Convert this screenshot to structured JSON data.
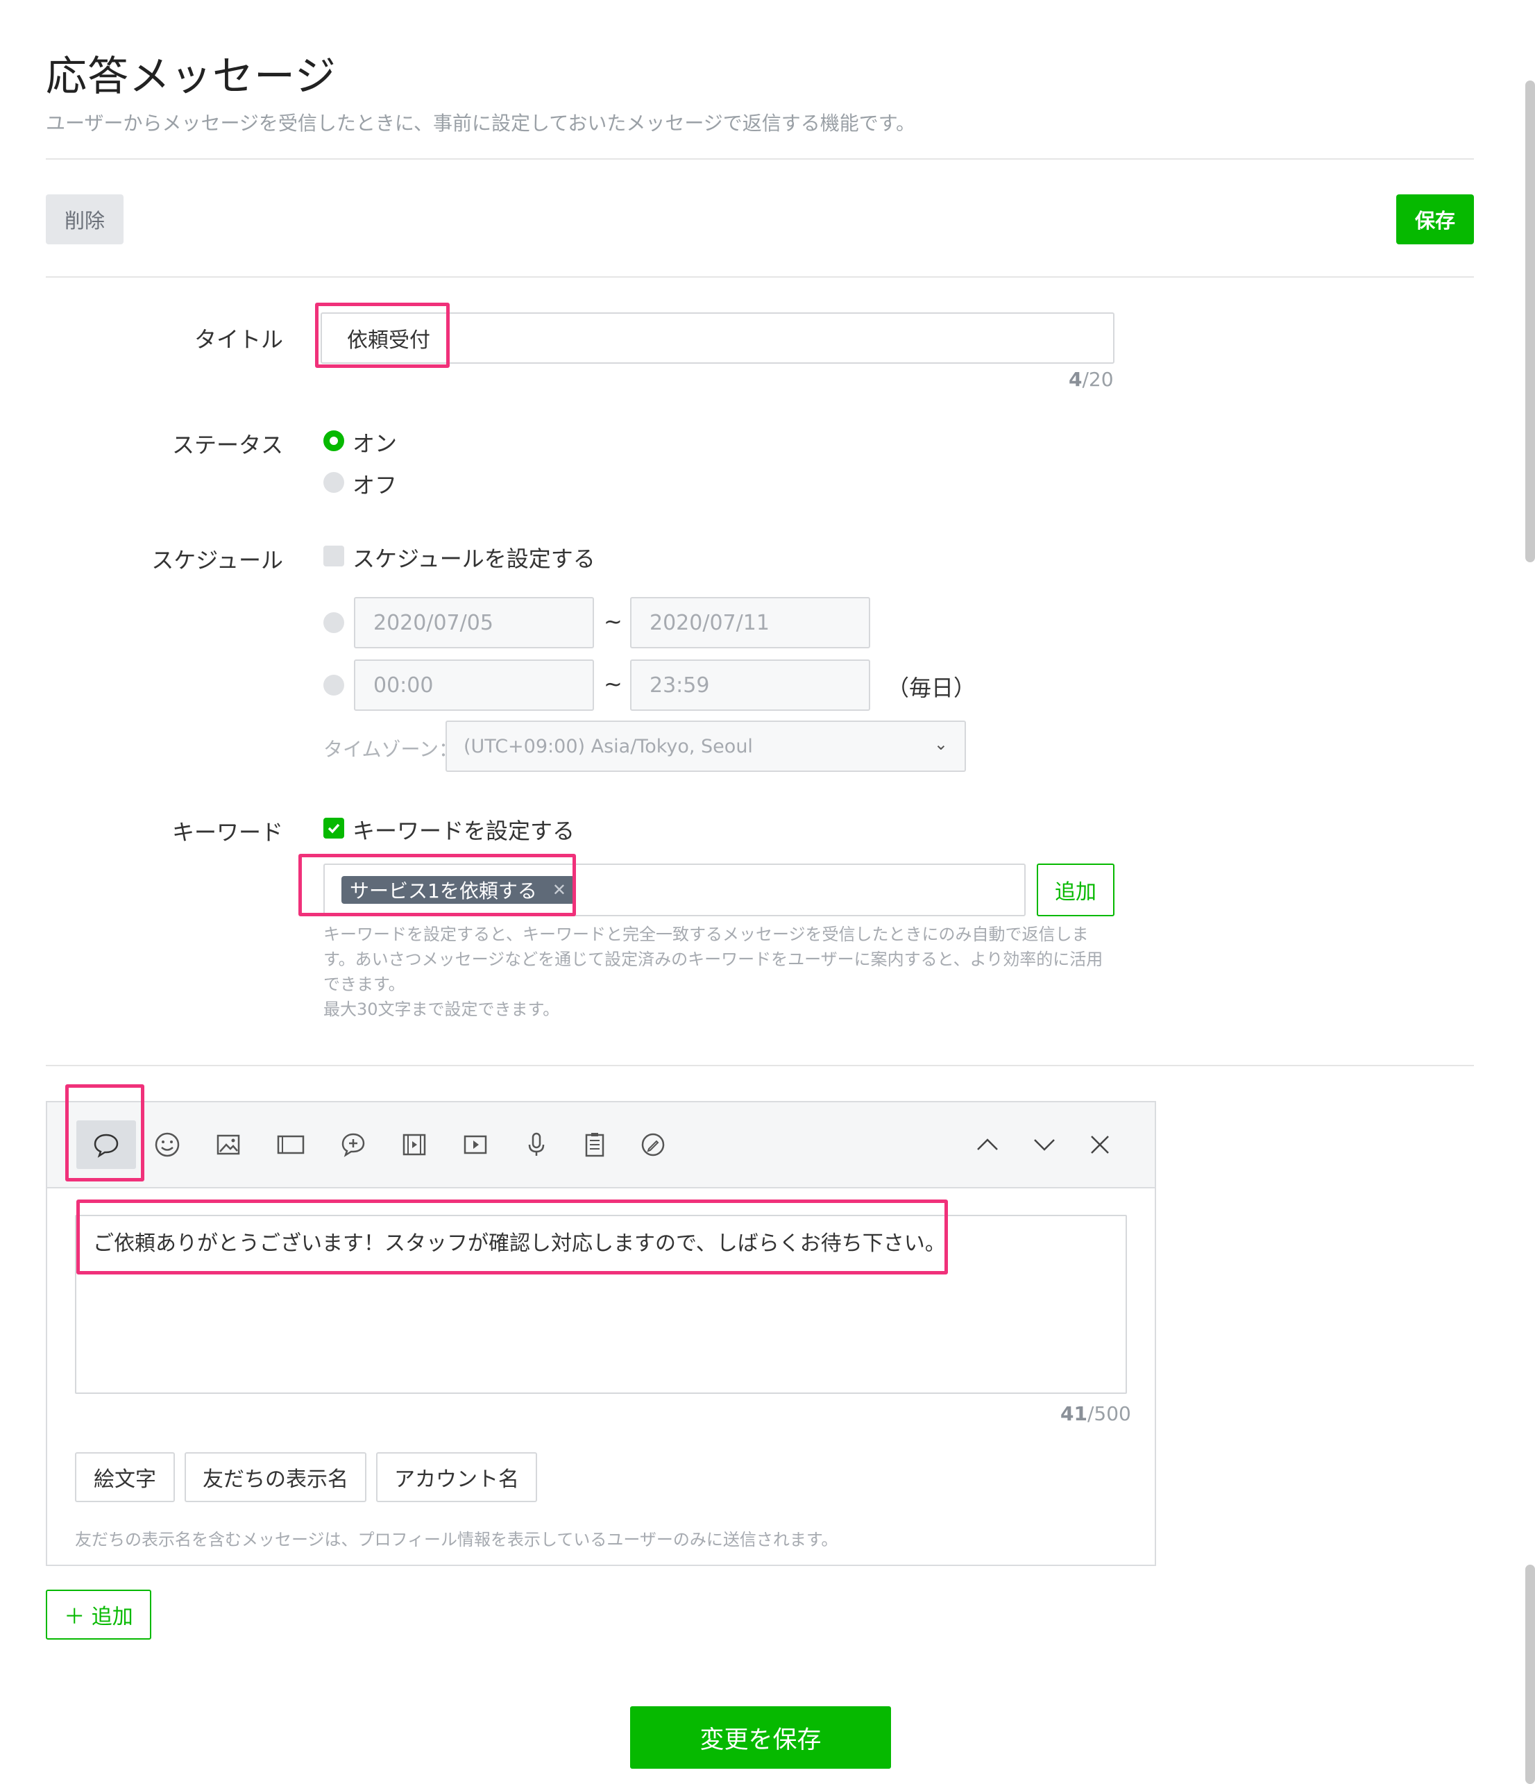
{
  "page": {
    "title": "応答メッセージ",
    "description": "ユーザーからメッセージを受信したときに、事前に設定しておいたメッセージで返信する機能です。"
  },
  "actions": {
    "delete_label": "削除",
    "save_label": "保存"
  },
  "title_field": {
    "label": "タイトル",
    "value": "依頼受付",
    "count": "4",
    "max": "/20"
  },
  "status": {
    "label": "ステータス",
    "option_on": "オン",
    "option_off": "オフ",
    "selected": "オン"
  },
  "schedule": {
    "label": "スケジュール",
    "checkbox_label": "スケジュールを設定する",
    "checked": false,
    "date_start": "2020/07/05",
    "date_end": "2020/07/11",
    "time_start": "00:00",
    "time_end": "23:59",
    "tilde": "~",
    "daily_label": "（毎日）",
    "timezone_label": "タイムゾーン：",
    "timezone_value": "(UTC+09:00) Asia/Tokyo, Seoul"
  },
  "keyword": {
    "label": "キーワード",
    "checkbox_label": "キーワードを設定する",
    "checked": true,
    "tag": "サービス1を依頼する",
    "add_label": "追加",
    "help_line1": "キーワードを設定すると、キーワードと完全一致するメッセージを受信したときにのみ自動で返信しま",
    "help_line2": "す。あいさつメッセージなどを通じて設定済みのキーワードをユーザーに案内すると、より効率的に活用",
    "help_line3": "できます。",
    "help_line4": "最大30文字まで設定できます。"
  },
  "editor": {
    "toolbar_icons": [
      "text-bubble-icon",
      "emoji-icon",
      "image-icon",
      "card-icon",
      "rich-message-icon",
      "video-icon",
      "rich-video-icon",
      "voice-icon",
      "survey-icon",
      "coupon-icon"
    ],
    "message": "ご依頼ありがとうございます！スタッフが確認し対応しますので、しばらくお待ち下さい。",
    "count": "41",
    "max": "/500",
    "chips": [
      "絵文字",
      "友だちの表示名",
      "アカウント名"
    ],
    "note": "友だちの表示名を含むメッセージは、プロフィール情報を表示しているユーザーのみに送信されます。"
  },
  "add_button_label": "＋ 追加",
  "save_changes_label": "変更を保存",
  "colors": {
    "accent": "#06b900",
    "highlight": "#f0317a",
    "tag_bg": "#5f6a78"
  }
}
